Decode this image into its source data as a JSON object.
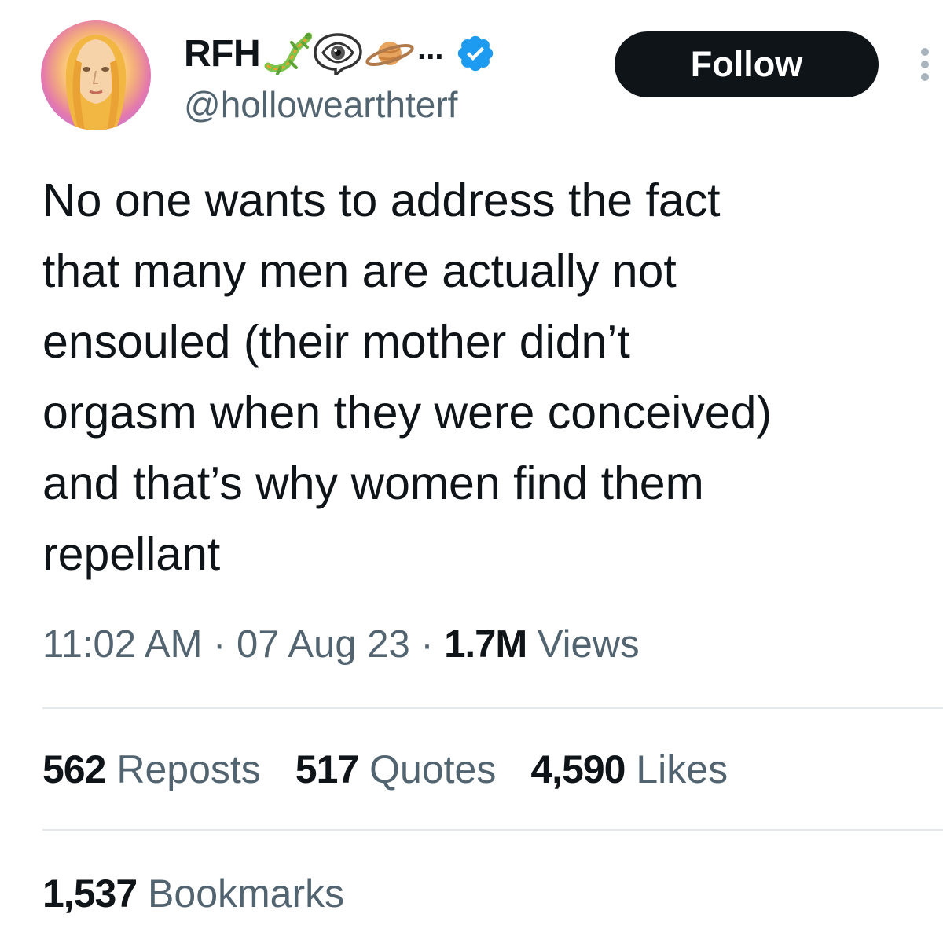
{
  "author": {
    "display_name": "RFH",
    "name_emojis": [
      "lizard-icon",
      "eye-in-speech-bubble-icon",
      "ringed-planet-icon"
    ],
    "ellipsis": "...",
    "verified": true,
    "handle": "@hollowearthterf"
  },
  "actions": {
    "follow_label": "Follow",
    "more_icon": "more-vertical-icon"
  },
  "tweet": {
    "text": "No one wants to address the fact\nthat many men are actually not\nensouled (their mother didn’t\norgasm when they were conceived)\nand that’s why women find them\nrepellant",
    "time": "11:02 AM",
    "date": "07 Aug 23",
    "separator": "·",
    "views_count": "1.7M",
    "views_label": "Views"
  },
  "stats": {
    "reposts_count": "562",
    "reposts_label": "Reposts",
    "quotes_count": "517",
    "quotes_label": "Quotes",
    "likes_count": "4,590",
    "likes_label": "Likes",
    "bookmarks_count": "1,537",
    "bookmarks_label": "Bookmarks"
  },
  "colors": {
    "text_primary": "#0f1419",
    "text_secondary": "#536471",
    "verified_blue": "#1d9bf0",
    "follow_bg": "#0f1419"
  }
}
